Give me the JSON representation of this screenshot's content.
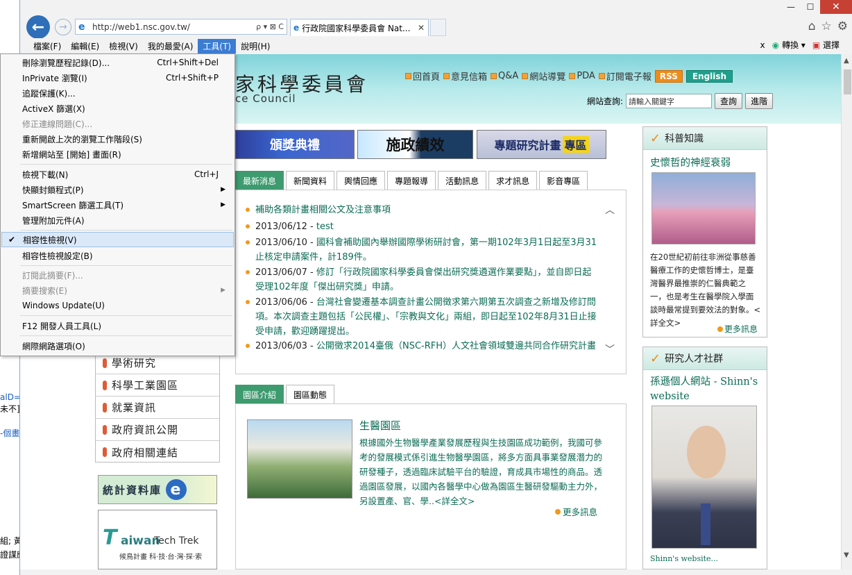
{
  "background_window": {
    "fragments": [
      "alD=",
      "未不]",
      "-個畫",
      "組; 黃",
      "證謀應"
    ]
  },
  "titlebar": {
    "minimize": "—",
    "maximize": "☐",
    "close": "✕"
  },
  "address_bar": {
    "url": "http://web1.nsc.gov.tw/",
    "tools": "ρ ▾ ⊠ C"
  },
  "tab": {
    "title": "行政院國家科學委員會 Nat...",
    "close": "✕"
  },
  "toolbar_right_icons": [
    "home-icon",
    "star-icon",
    "gear-icon"
  ],
  "menubar": {
    "items": [
      {
        "label": "檔案(F)",
        "active": false
      },
      {
        "label": "編輯(E)",
        "active": false
      },
      {
        "label": "檢視(V)",
        "active": false
      },
      {
        "label": "我的最愛(A)",
        "active": false
      },
      {
        "label": "工具(T)",
        "active": true
      },
      {
        "label": "說明(H)",
        "active": false
      }
    ],
    "right": {
      "close_x": "x",
      "convert_label": "轉換",
      "select_label": "選擇"
    }
  },
  "tools_menu": {
    "items": [
      {
        "label": "刪除瀏覽歷程記錄(D)...",
        "shortcut": "Ctrl+Shift+Del"
      },
      {
        "label": "InPrivate 瀏覽(I)",
        "shortcut": "Ctrl+Shift+P"
      },
      {
        "label": "追蹤保護(K)..."
      },
      {
        "label": "ActiveX 篩選(X)"
      },
      {
        "label": "修正連線問題(C)...",
        "disabled": true
      },
      {
        "label": "重新開啟上次的瀏覽工作階段(S)"
      },
      {
        "label": "新增網站至 [開始] 畫面(R)"
      },
      {
        "label": "檢視下載(N)",
        "shortcut": "Ctrl+J"
      },
      {
        "label": "快顯封鎖程式(P)",
        "submenu": true
      },
      {
        "label": "SmartScreen 篩選工具(T)",
        "submenu": true
      },
      {
        "label": "管理附加元件(A)"
      },
      {
        "label": "相容性檢視(V)",
        "checked": true,
        "highlighted": true
      },
      {
        "label": "相容性檢視設定(B)"
      },
      {
        "label": "訂閱此摘要(F)...",
        "disabled": true
      },
      {
        "label": "摘要搜索(E)",
        "disabled": true,
        "submenu": true
      },
      {
        "label": "Windows Update(U)"
      },
      {
        "label": "F12 開發人員工具(L)"
      },
      {
        "label": "網際網路選項(O)"
      }
    ]
  },
  "header": {
    "title": "家科學委員會",
    "subtitle": "ce Council",
    "links": [
      "回首頁",
      "意見信箱",
      "Q&A",
      "網站導覽",
      "PDA",
      "訂閱電子報"
    ],
    "rss": "RSS",
    "english": "English",
    "search_label": "網站查詢:",
    "search_placeholder": "請輸入關鍵字",
    "search_button": "查詢",
    "advanced_button": "進階"
  },
  "banners": {
    "award": "頒獎典禮",
    "performance": "施政績效",
    "research_left": "專題研究計畫",
    "research_hl": "專區"
  },
  "news_tabs": [
    "最新消息",
    "新聞資料",
    "輿情回應",
    "專題報導",
    "活動訊息",
    "求才訊息",
    "影音專區"
  ],
  "news": [
    {
      "date": "",
      "text": "補助各類計畫相關公文及注意事項"
    },
    {
      "date": "2013/06/12 - ",
      "text": "test"
    },
    {
      "date": "2013/06/10 - ",
      "text": "國科會補助國內舉辦國際學術研討會，第一期102年3月1日起至3月31止核定申請案件，計189件。"
    },
    {
      "date": "2013/06/07 - ",
      "text": "修訂「行政院國家科學委員會傑出研究獎遴選作業要點」，並自即日起受理102年度「傑出研究獎」申請。"
    },
    {
      "date": "2013/06/06 - ",
      "text": "台灣社會變遷基本調查計畫公開徵求第六期第五次調查之新增及修訂問項。本次調查主題包括「公民權」、「宗教與文化」兩組，即日起至102年8月31日止接受申請，歡迎踴躍提出。"
    },
    {
      "date": "2013/06/03 - ",
      "text": "公開徵求2014臺俄（NSC-RFH）人文社會領域雙邊共同合作研究計畫"
    }
  ],
  "park_tabs": [
    "園區介紹",
    "園區動態"
  ],
  "park": {
    "title": "生醫園區",
    "text": "根據國外生物醫學產業發展歷程與生技園區成功範例，我國可參考的發展模式係引進生物醫學園區，將多方面具事業發展潛力的研發種子，透過臨床試驗平台的驗證，育成具市場性的商品。透過園區發展，以國內各醫學中心做為園區生醫研發驅動主力外，另設置產、官、學..<詳全文>",
    "more": "更多訊息"
  },
  "left_nav": [
    "學術研究",
    "科學工業園區",
    "就業資訊",
    "政府資訊公開",
    "政府相關連結"
  ],
  "stat_banner": {
    "label": "統計資料庫",
    "logo": "e"
  },
  "taiwan_banner": {
    "a": "T",
    "b": "aiwan",
    "c": "Tech Trek",
    "d": "候鳥計畫 科·技·台·灣·探·索"
  },
  "science_box": {
    "heading": "科普知識",
    "title": "史懷哲的神經衰弱",
    "text": "在20世紀初前往非洲從事慈善醫療工作的史懷哲博士，是臺灣醫界最推崇的仁醫典範之一，也是考生在醫學院入學面談時最常提到要效法的對象。<詳全文>",
    "more": "更多訊息"
  },
  "talent_box": {
    "heading": "研究人才社群",
    "title": "孫遜個人網站 - Shinn's website",
    "link": "Shinn's website..."
  }
}
